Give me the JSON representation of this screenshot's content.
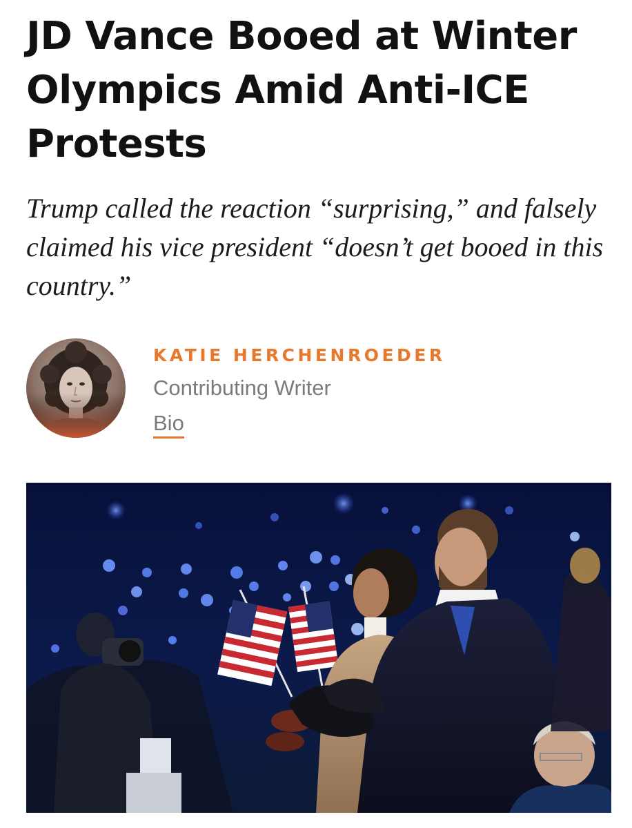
{
  "article": {
    "headline": "JD Vance Booed at Winter Olympics Amid Anti-ICE Protests",
    "dek": "Trump called the reaction “surprising,” and falsely claimed his vice president “doesn’t get booed in this country.”",
    "author": {
      "name": "KATIE HERCHENROEDER",
      "role": "Contributing Writer",
      "bio_label": "Bio"
    }
  },
  "colors": {
    "accent": "#e8782c",
    "text": "#111111",
    "muted": "#7a7a7a"
  }
}
